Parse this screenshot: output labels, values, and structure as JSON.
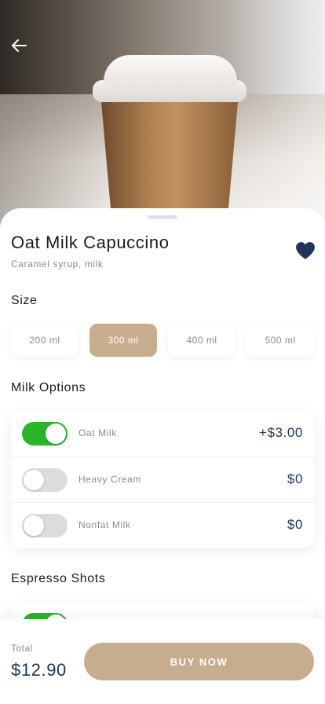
{
  "product": {
    "name": "Oat Milk Capuccino",
    "description": "Caramel syrup, milk",
    "favorite": true
  },
  "icons": {
    "back": "back-arrow-icon",
    "favorite": "heart-icon"
  },
  "colors": {
    "accent": "#c6ad8d",
    "price_text": "#1f3557",
    "toggle_on": "#2bb52a",
    "toggle_off": "#dcdcdc",
    "heart": "#1f3557"
  },
  "size_section": {
    "label": "Size",
    "options": [
      "200 ml",
      "300 ml",
      "400 ml",
      "500 ml"
    ],
    "selected": "300 ml"
  },
  "milk_section": {
    "label": "Milk Options",
    "options": [
      {
        "name": "Oat Milk",
        "price": "+$3.00",
        "enabled": true
      },
      {
        "name": "Heavy Cream",
        "price": "$0",
        "enabled": false
      },
      {
        "name": "Nonfat Milk",
        "price": "$0",
        "enabled": false
      }
    ]
  },
  "espresso_section": {
    "label": "Espresso Shots",
    "first_toggle_enabled": true
  },
  "footer": {
    "total_label": "Total",
    "total_price": "$12.90",
    "buy_label": "BUY NOW"
  }
}
